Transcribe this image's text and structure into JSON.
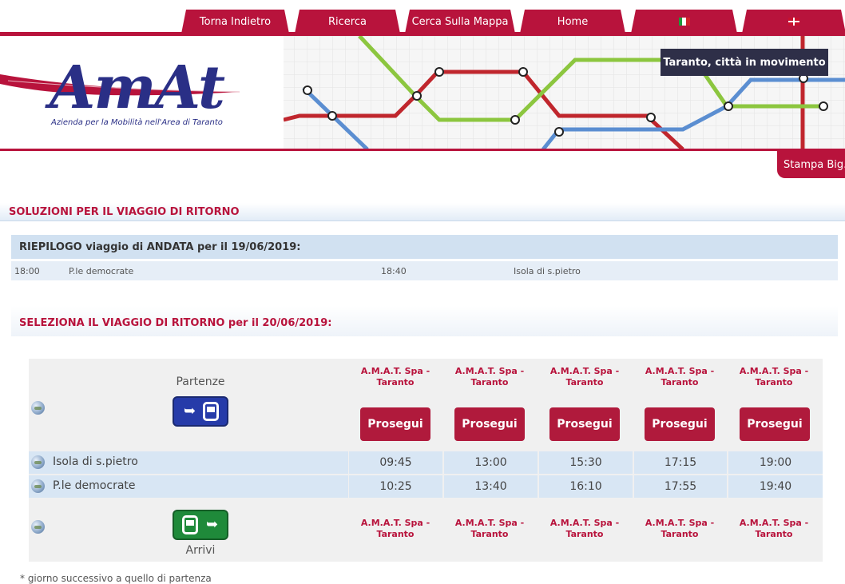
{
  "nav": {
    "items": [
      "Torna Indietro",
      "Ricerca",
      "Cerca Sulla Mappa",
      "Home"
    ]
  },
  "banner": {
    "logo": "AmAt",
    "subtitle": "Azienda per la Mobilità nell'Area di Taranto",
    "motto": "Taranto, città in movimento",
    "print": "Stampa Big."
  },
  "page": {
    "title": "SOLUZIONI PER IL VIAGGIO DI RITORNO"
  },
  "summary": {
    "title": "RIEPILOGO viaggio di ANDATA per il 19/06/2019:",
    "dep_time": "18:00",
    "dep_stop": "P.le democrate",
    "arr_time": "18:40",
    "arr_stop": "Isola di s.pietro"
  },
  "select": {
    "title": "SELEZIONA IL VIAGGIO DI RITORNO per il 20/06/2019:"
  },
  "table": {
    "departures_label": "Partenze",
    "arrivals_label": "Arrivi",
    "operator": "A.M.A.T. Spa - Taranto",
    "button": "Prosegui",
    "stops": [
      {
        "name": "Isola di s.pietro",
        "times": [
          "09:45",
          "13:00",
          "15:30",
          "17:15",
          "19:00"
        ]
      },
      {
        "name": "P.le democrate",
        "times": [
          "10:25",
          "13:40",
          "16:10",
          "17:55",
          "19:40"
        ]
      }
    ]
  },
  "footnote": "* giorno successivo a quello di partenza",
  "colors": {
    "accent": "#b8133c",
    "navy": "#2a2f86",
    "row": "#d8e6f4"
  }
}
